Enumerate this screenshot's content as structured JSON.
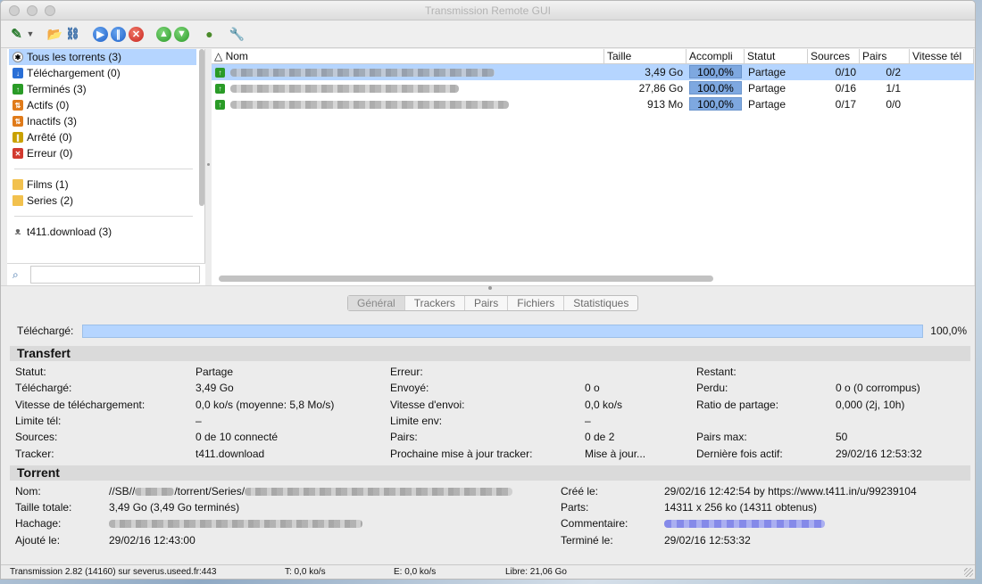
{
  "window": {
    "title": "Transmission Remote GUI"
  },
  "sidebar": {
    "items": [
      {
        "label": "Tous les torrents (3)",
        "icon": "all-torrents-icon"
      },
      {
        "label": "Téléchargement (0)",
        "icon": "download-icon"
      },
      {
        "label": "Terminés (3)",
        "icon": "completed-icon"
      },
      {
        "label": "Actifs (0)",
        "icon": "active-icon"
      },
      {
        "label": "Inactifs (3)",
        "icon": "inactive-icon"
      },
      {
        "label": "Arrêté (0)",
        "icon": "stopped-icon"
      },
      {
        "label": "Erreur (0)",
        "icon": "error-icon"
      }
    ],
    "folders": [
      {
        "label": "Films (1)"
      },
      {
        "label": "Series (2)"
      }
    ],
    "trackers": [
      {
        "label": "t411.download (3)"
      }
    ],
    "search": {
      "value": ""
    }
  },
  "table": {
    "headers": {
      "name": "Nom",
      "size": "Taille",
      "done": "Accompli",
      "status": "Statut",
      "seeds": "Sources",
      "peers": "Pairs",
      "speed": "Vitesse tél"
    },
    "rows": [
      {
        "size": "3,49 Go",
        "done": "100,0%",
        "status": "Partage",
        "seeds": "0/10",
        "peers": "0/2",
        "selected": true
      },
      {
        "size": "27,86 Go",
        "done": "100,0%",
        "status": "Partage",
        "seeds": "0/16",
        "peers": "1/1",
        "selected": false
      },
      {
        "size": "913 Mo",
        "done": "100,0%",
        "status": "Partage",
        "seeds": "0/17",
        "peers": "0/0",
        "selected": false
      }
    ]
  },
  "tabs": [
    "Général",
    "Trackers",
    "Pairs",
    "Fichiers",
    "Statistiques"
  ],
  "downloaded": {
    "label": "Téléchargé:",
    "percent": "100,0%",
    "fraction": 1.0
  },
  "transfer": {
    "title": "Transfert",
    "col1": [
      {
        "label": "Statut:",
        "value": "Partage"
      },
      {
        "label": "Téléchargé:",
        "value": "3,49 Go"
      },
      {
        "label": "Vitesse de téléchargement:",
        "value": "0,0 ko/s (moyenne: 5,8 Mo/s)"
      },
      {
        "label": "Limite tél:",
        "value": "–"
      },
      {
        "label": "Sources:",
        "value": "0 de 10 connecté"
      },
      {
        "label": "Tracker:",
        "value": "t411.download"
      }
    ],
    "col2": [
      {
        "label": "Erreur:",
        "value": ""
      },
      {
        "label": "Envoyé:",
        "value": "0 o"
      },
      {
        "label": "Vitesse d'envoi:",
        "value": "0,0 ko/s"
      },
      {
        "label": "Limite env:",
        "value": "–"
      },
      {
        "label": "Pairs:",
        "value": "0 de 2"
      },
      {
        "label": "Prochaine mise à jour tracker:",
        "value": "Mise à jour..."
      }
    ],
    "col3": [
      {
        "label": "Restant:",
        "value": ""
      },
      {
        "label": "Perdu:",
        "value": "0 o (0 corrompus)"
      },
      {
        "label": "Ratio de partage:",
        "value": "0,000 (2j, 10h)"
      },
      {
        "label": "",
        "value": ""
      },
      {
        "label": "Pairs max:",
        "value": "50"
      },
      {
        "label": "Dernière fois actif:",
        "value": "29/02/16 12:53:32"
      }
    ]
  },
  "torrent": {
    "title": "Torrent",
    "name_label": "Nom:",
    "name_prefix": "//SB//",
    "name_mid": "/torrent/Series/",
    "size_label": "Taille totale:",
    "size_value": "3,49 Go (3,49 Go terminés)",
    "hash_label": "Hachage:",
    "added_label": "Ajouté le:",
    "added_value": "29/02/16 12:43:00",
    "created_label": "Créé le:",
    "created_value": "29/02/16 12:42:54  by https://www.t411.in/u/99239104",
    "parts_label": "Parts:",
    "parts_value": "14311 x 256 ko (14311 obtenus)",
    "comment_label": "Commentaire:",
    "finished_label": "Terminé le:",
    "finished_value": "29/02/16 12:53:32"
  },
  "statusbar": {
    "version": "Transmission 2.82 (14160) sur severus.useed.fr:443",
    "download": "T: 0,0 ko/s",
    "upload": "E: 0,0 ko/s",
    "free": "Libre: 21,06 Go"
  }
}
